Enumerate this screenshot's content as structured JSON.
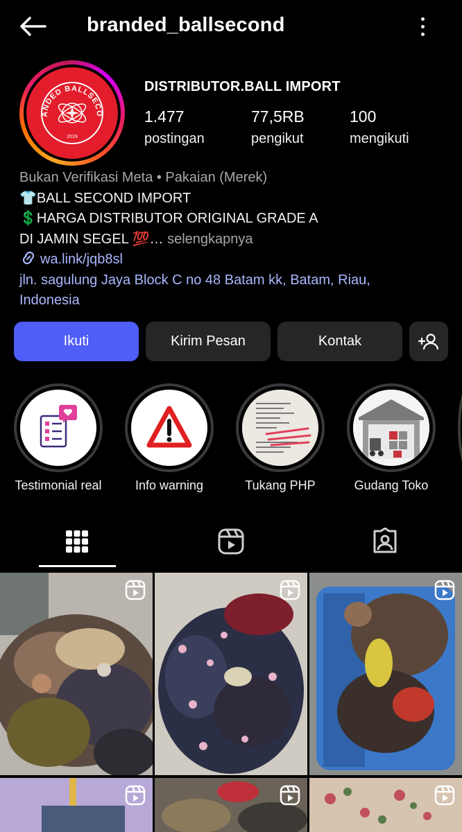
{
  "header": {
    "username": "branded_ballsecond"
  },
  "profile": {
    "display_name": "DISTRIBUTOR.BALL IMPORT",
    "avatar_text": "BRANDED BALLSECOND",
    "avatar_year": "2019",
    "stats": [
      {
        "value": "1.477",
        "label": "postingan"
      },
      {
        "value": "77,5RB",
        "label": "pengikut"
      },
      {
        "value": "100",
        "label": "mengikuti"
      }
    ]
  },
  "bio": {
    "category": "Bukan Verifikasi Meta • Pakaian (Merek)",
    "line1": "👕BALL SECOND IMPORT",
    "line2": "💲HARGA DISTRIBUTOR  ORIGINAL GRADE A",
    "line3": "DI JAMIN SEGEL 💯…",
    "more": "selengkapnya",
    "link": "wa.link/jqb8sl",
    "address_line1": "jln. sagulung Jaya Block C no 48 Batam kk, Batam, Riau,",
    "address_line2": "Indonesia"
  },
  "actions": {
    "follow": "Ikuti",
    "message": "Kirim Pesan",
    "contact": "Kontak"
  },
  "highlights": [
    {
      "label": "Testimonial real"
    },
    {
      "label": "Info warning"
    },
    {
      "label": "Tukang PHP"
    },
    {
      "label": "Gudang Toko"
    }
  ],
  "colors": {
    "accent": "#4f5ef7",
    "button_bg": "#262626",
    "link": "#a9b8ff",
    "avatar_red": "#e31d2b"
  }
}
